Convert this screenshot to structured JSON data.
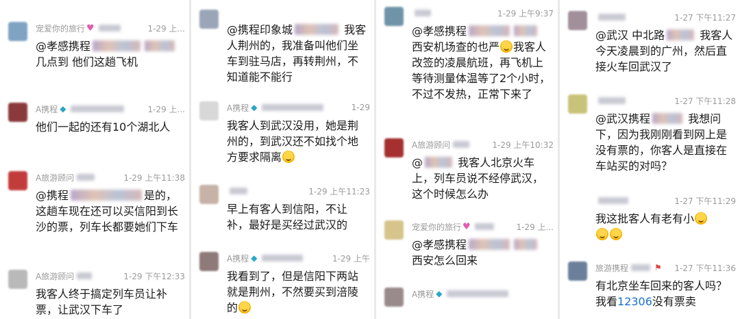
{
  "panels": [
    {
      "messages": [
        {
          "name": "宠爱你的旅行",
          "time": "1-29 上...",
          "lines": [
            "@孝感携程",
            "几点到 他们这趟飞机"
          ],
          "avatar": "#7fa3c2"
        },
        {
          "name": "A携程",
          "time": "1-29 上...",
          "lines": [
            "他们一起的还有10个湖北人"
          ],
          "avatar": "#8a3a3a"
        },
        {
          "name": "A旅游顾问",
          "time": "1-29 上午11:38",
          "lines": [
            "@携程",
            "是的，这趟车现在还可以买信阳到长沙的票，列车长都要她们下车"
          ],
          "avatar": "#c33c3c"
        },
        {
          "name": "A旅游顾问",
          "time": "1-29 下午12:33",
          "lines": [
            "我客人终于搞定列车员让补票，让武汉下车了"
          ],
          "avatar": "#b9b9b9"
        }
      ]
    },
    {
      "messages": [
        {
          "name": "",
          "time": "",
          "lines": [
            "@携程印象城",
            "我客人荆州的，我准备叫他们坐车到驻马店，再转荆州，不知道能不能行"
          ],
          "avatar": "#9aa6b8"
        },
        {
          "name": "A携程",
          "time": "1-29",
          "lines": [
            "我客人到武汉没用，她是荆州的，到武汉还不如找个地方要求隔离"
          ],
          "avatar": "#d8d8d8"
        },
        {
          "name": "",
          "time": "1-29 上午11:23",
          "lines": [
            "早上有客人到信阳，不让补，最好是买经过武汉的"
          ],
          "avatar": "#c7b2a8"
        },
        {
          "name": "A携程",
          "time": "1-29 上午",
          "lines": [
            "我看到了，但是信阳下两站就是荆州，不然要买到涪陵的"
          ],
          "avatar": "#8f7a7a"
        }
      ]
    },
    {
      "messages": [
        {
          "name": "",
          "time": "1-29 上午9:37",
          "lines": [
            "@孝感携程",
            "西安机场查的也严",
            "我客人改签的凌晨航班，再飞机上等待测量体温等了2个小时，不过不发热，正常下来了"
          ],
          "avatar": "#6f94a8"
        },
        {
          "name": "A旅游顾问",
          "time": "1-29 上午10:32",
          "lines": [
            "@",
            "我客人北京火车上，列车员说不经停武汉，这个时候怎么办"
          ],
          "avatar": "#a53030"
        },
        {
          "name": "宠爱你的旅行",
          "time": "1-29 上...",
          "lines": [
            "@孝感携程",
            "西安怎么回来"
          ],
          "avatar": "#d6c48a"
        },
        {
          "name": "A携程",
          "time": "",
          "lines": [],
          "avatar": "#9a8b8b"
        }
      ]
    },
    {
      "messages": [
        {
          "name": "",
          "time": "1-27 下午11:27",
          "lines": [
            "@武汉 中北路",
            "我客人今天凌晨到的广州，然后直接火车回武汉了"
          ],
          "avatar": "#a18f9a"
        },
        {
          "name": "",
          "time": "1-27 下午11:28",
          "lines": [
            "@武汉携程",
            "我想问下，因为我刚刚看到网上是没有票的，你客人是直接在车站买的对吗？"
          ],
          "avatar": "#c9c27a"
        },
        {
          "name": "",
          "time": "1-27 下午11:29",
          "lines": [
            "我这批客人有老有小"
          ],
          "avatar": "#ffffff"
        },
        {
          "name": "旅游携程",
          "time": "1-27 下午11:36",
          "lines": [
            "有北京坐车回来的客人吗？我看",
            "12306",
            "没有票卖"
          ],
          "avatar": "#6b7f9a"
        }
      ]
    }
  ],
  "colors": {
    "link_blue": "#1a6fd0",
    "meta_gray": "#9a9a9a"
  }
}
